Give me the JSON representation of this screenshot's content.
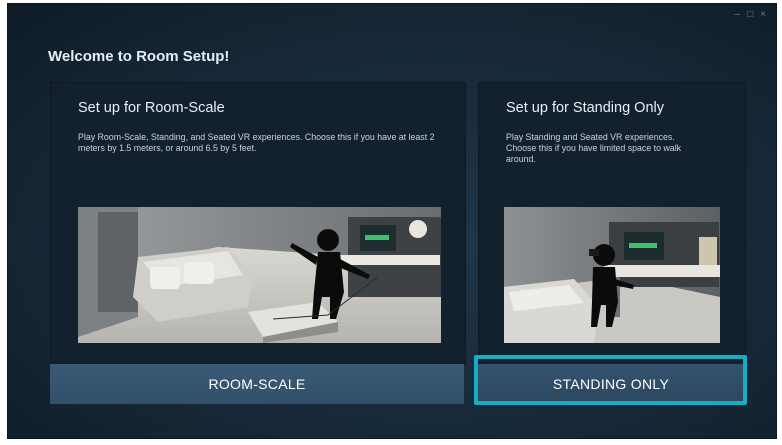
{
  "window": {
    "title": "Welcome to Room Setup!",
    "controls": [
      "minimize",
      "restore",
      "close"
    ]
  },
  "options": [
    {
      "heading": "Set up for Room-Scale",
      "description": "Play Room-Scale, Standing, and Seated VR experiences. Choose this if you have at least 2 meters by 1.5 meters, or around 6.5 by 5 feet.",
      "button_label": "ROOM-SCALE"
    },
    {
      "heading": "Set up for Standing Only",
      "description": "Play Standing and Seated VR experiences. Choose this if you have limited space to walk around.",
      "button_label": "STANDING ONLY",
      "highlighted": true
    }
  ],
  "colors": {
    "background": "#172939",
    "panel": "#13212e",
    "button": "#3a5a76",
    "highlight": "#16aec4"
  }
}
